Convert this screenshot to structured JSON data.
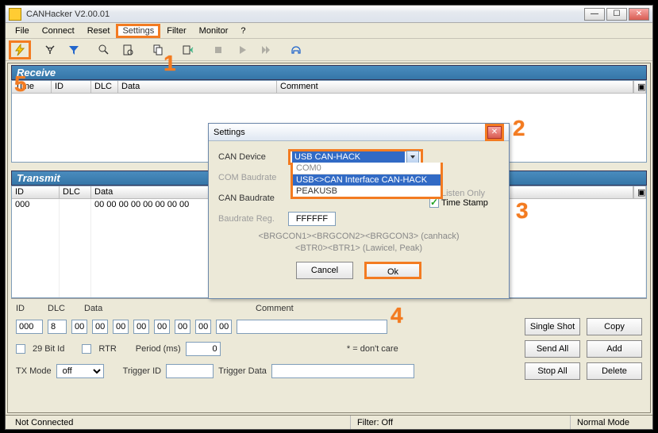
{
  "title": "CANHacker V2.00.01",
  "menu": {
    "file": "File",
    "connect": "Connect",
    "reset": "Reset",
    "settings": "Settings",
    "filter": "Filter",
    "monitor": "Monitor",
    "help": "?"
  },
  "panels": {
    "receive": "Receive",
    "transmit": "Transmit"
  },
  "cols": {
    "time": "Time",
    "id": "ID",
    "dlc": "DLC",
    "data": "Data",
    "comment": "Comment"
  },
  "transmit_row": {
    "id": "000",
    "dlc": "",
    "data": "00 00 00 00 00 00 00 00"
  },
  "editor": {
    "id_label": "ID",
    "id_val": "000",
    "dlc_label": "DLC",
    "dlc_val": "8",
    "data_label": "Data",
    "data_vals": [
      "00",
      "00",
      "00",
      "00",
      "00",
      "00",
      "00",
      "00"
    ],
    "comment_label": "Comment",
    "comment_val": "",
    "bit29": "29 Bit Id",
    "rtr": "RTR",
    "period_label": "Period (ms)",
    "period_val": "0",
    "txmode_label": "TX Mode",
    "txmode_val": "off",
    "trigid_label": "Trigger ID",
    "trigid_val": "",
    "trigdata_label": "Trigger Data",
    "trigdata_val": "",
    "dontcare": "* = don't care"
  },
  "buttons": {
    "single": "Single Shot",
    "copy": "Copy",
    "sendall": "Send All",
    "add": "Add",
    "stopall": "Stop All",
    "delete": "Delete"
  },
  "status": {
    "conn": "Not Connected",
    "filter": "Filter: Off",
    "mode": "Normal Mode"
  },
  "dialog": {
    "title": "Settings",
    "can_device_label": "CAN Device",
    "can_device_val": "USB CAN-HACK",
    "can_device_opt1": "USB<>CAN Interface CAN-HACK",
    "can_device_opt2": "PEAKUSB",
    "com_baud_label": "COM Baudrate",
    "com_baud_opt0": "COM0",
    "can_baud_label": "CAN Baudrate",
    "baudreg_label": "Baudrate Reg.",
    "baudreg_val": "FFFFFF",
    "listen_only": "Listen Only",
    "timestamp": "Time Stamp",
    "hint1": "<BRGCON1><BRGCON2><BRGCON3> (canhack)",
    "hint2": "<BTR0><BTR1> (Lawicel, Peak)",
    "cancel": "Cancel",
    "ok": "Ok"
  },
  "annotations": {
    "a1": "1",
    "a2": "2",
    "a3": "3",
    "a4": "4",
    "a5": "5"
  },
  "icons": {
    "flash": "flash-icon",
    "tools": "tools-icon",
    "filter": "funnel-icon",
    "zoom": "zoom-icon",
    "page": "page-icon",
    "copy": "copy-icon",
    "export": "export-icon",
    "stop": "stop-icon",
    "play": "play-icon",
    "ff": "forward-icon",
    "headset": "headset-icon"
  }
}
